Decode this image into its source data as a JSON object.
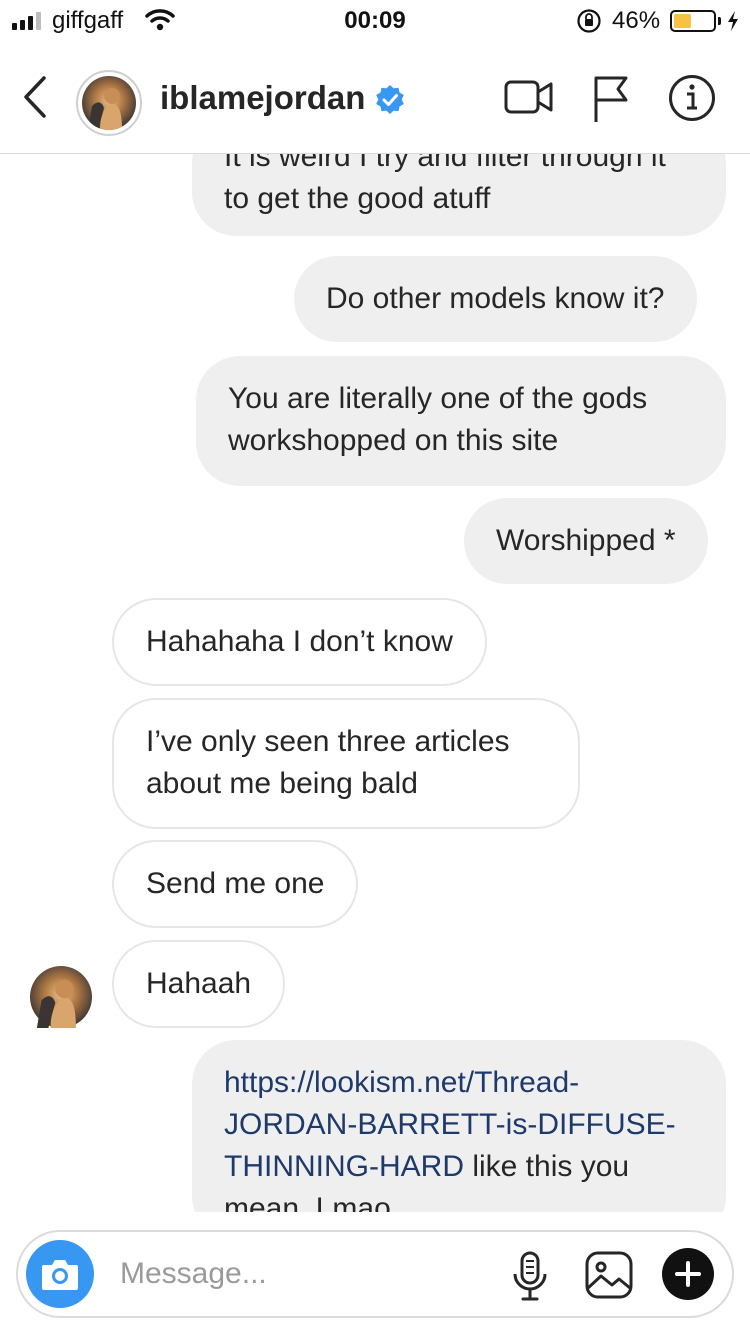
{
  "status_bar": {
    "carrier": "giffgaff",
    "time": "00:09",
    "battery_percent": "46%",
    "battery_level": 0.46
  },
  "header": {
    "username": "iblamejordan",
    "icons": [
      "back-chevron-icon",
      "verified-badge-icon",
      "video-call-icon",
      "flag-icon",
      "info-icon"
    ]
  },
  "messages": [
    {
      "side": "sent",
      "text": "It is weird I try and filter through it to get the good atuff"
    },
    {
      "side": "sent",
      "text": "Do other models know it?"
    },
    {
      "side": "sent",
      "text": "You are literally one of the gods workshopped on this site"
    },
    {
      "side": "sent",
      "text": "Worshipped *"
    },
    {
      "side": "received",
      "text": "Hahahaha I don’t know"
    },
    {
      "side": "received",
      "text": "I’ve only seen three articles about me being bald"
    },
    {
      "side": "received",
      "text": "Send me one"
    },
    {
      "side": "received",
      "text": "Hahaah"
    },
    {
      "side": "sent",
      "link": "https://lookism.net/Thread-JORDAN-BARRETT-is-DIFFUSE-THINNING-HARD",
      "text": " like this you mean. Lmao"
    }
  ],
  "composer": {
    "placeholder": "Message...",
    "icons": [
      "camera-icon",
      "microphone-icon",
      "gallery-icon",
      "plus-icon"
    ]
  },
  "colors": {
    "accent": "#3897f0",
    "sent_bubble": "#efefef",
    "link": "#1e3a6b",
    "battery": "#f5c242"
  }
}
